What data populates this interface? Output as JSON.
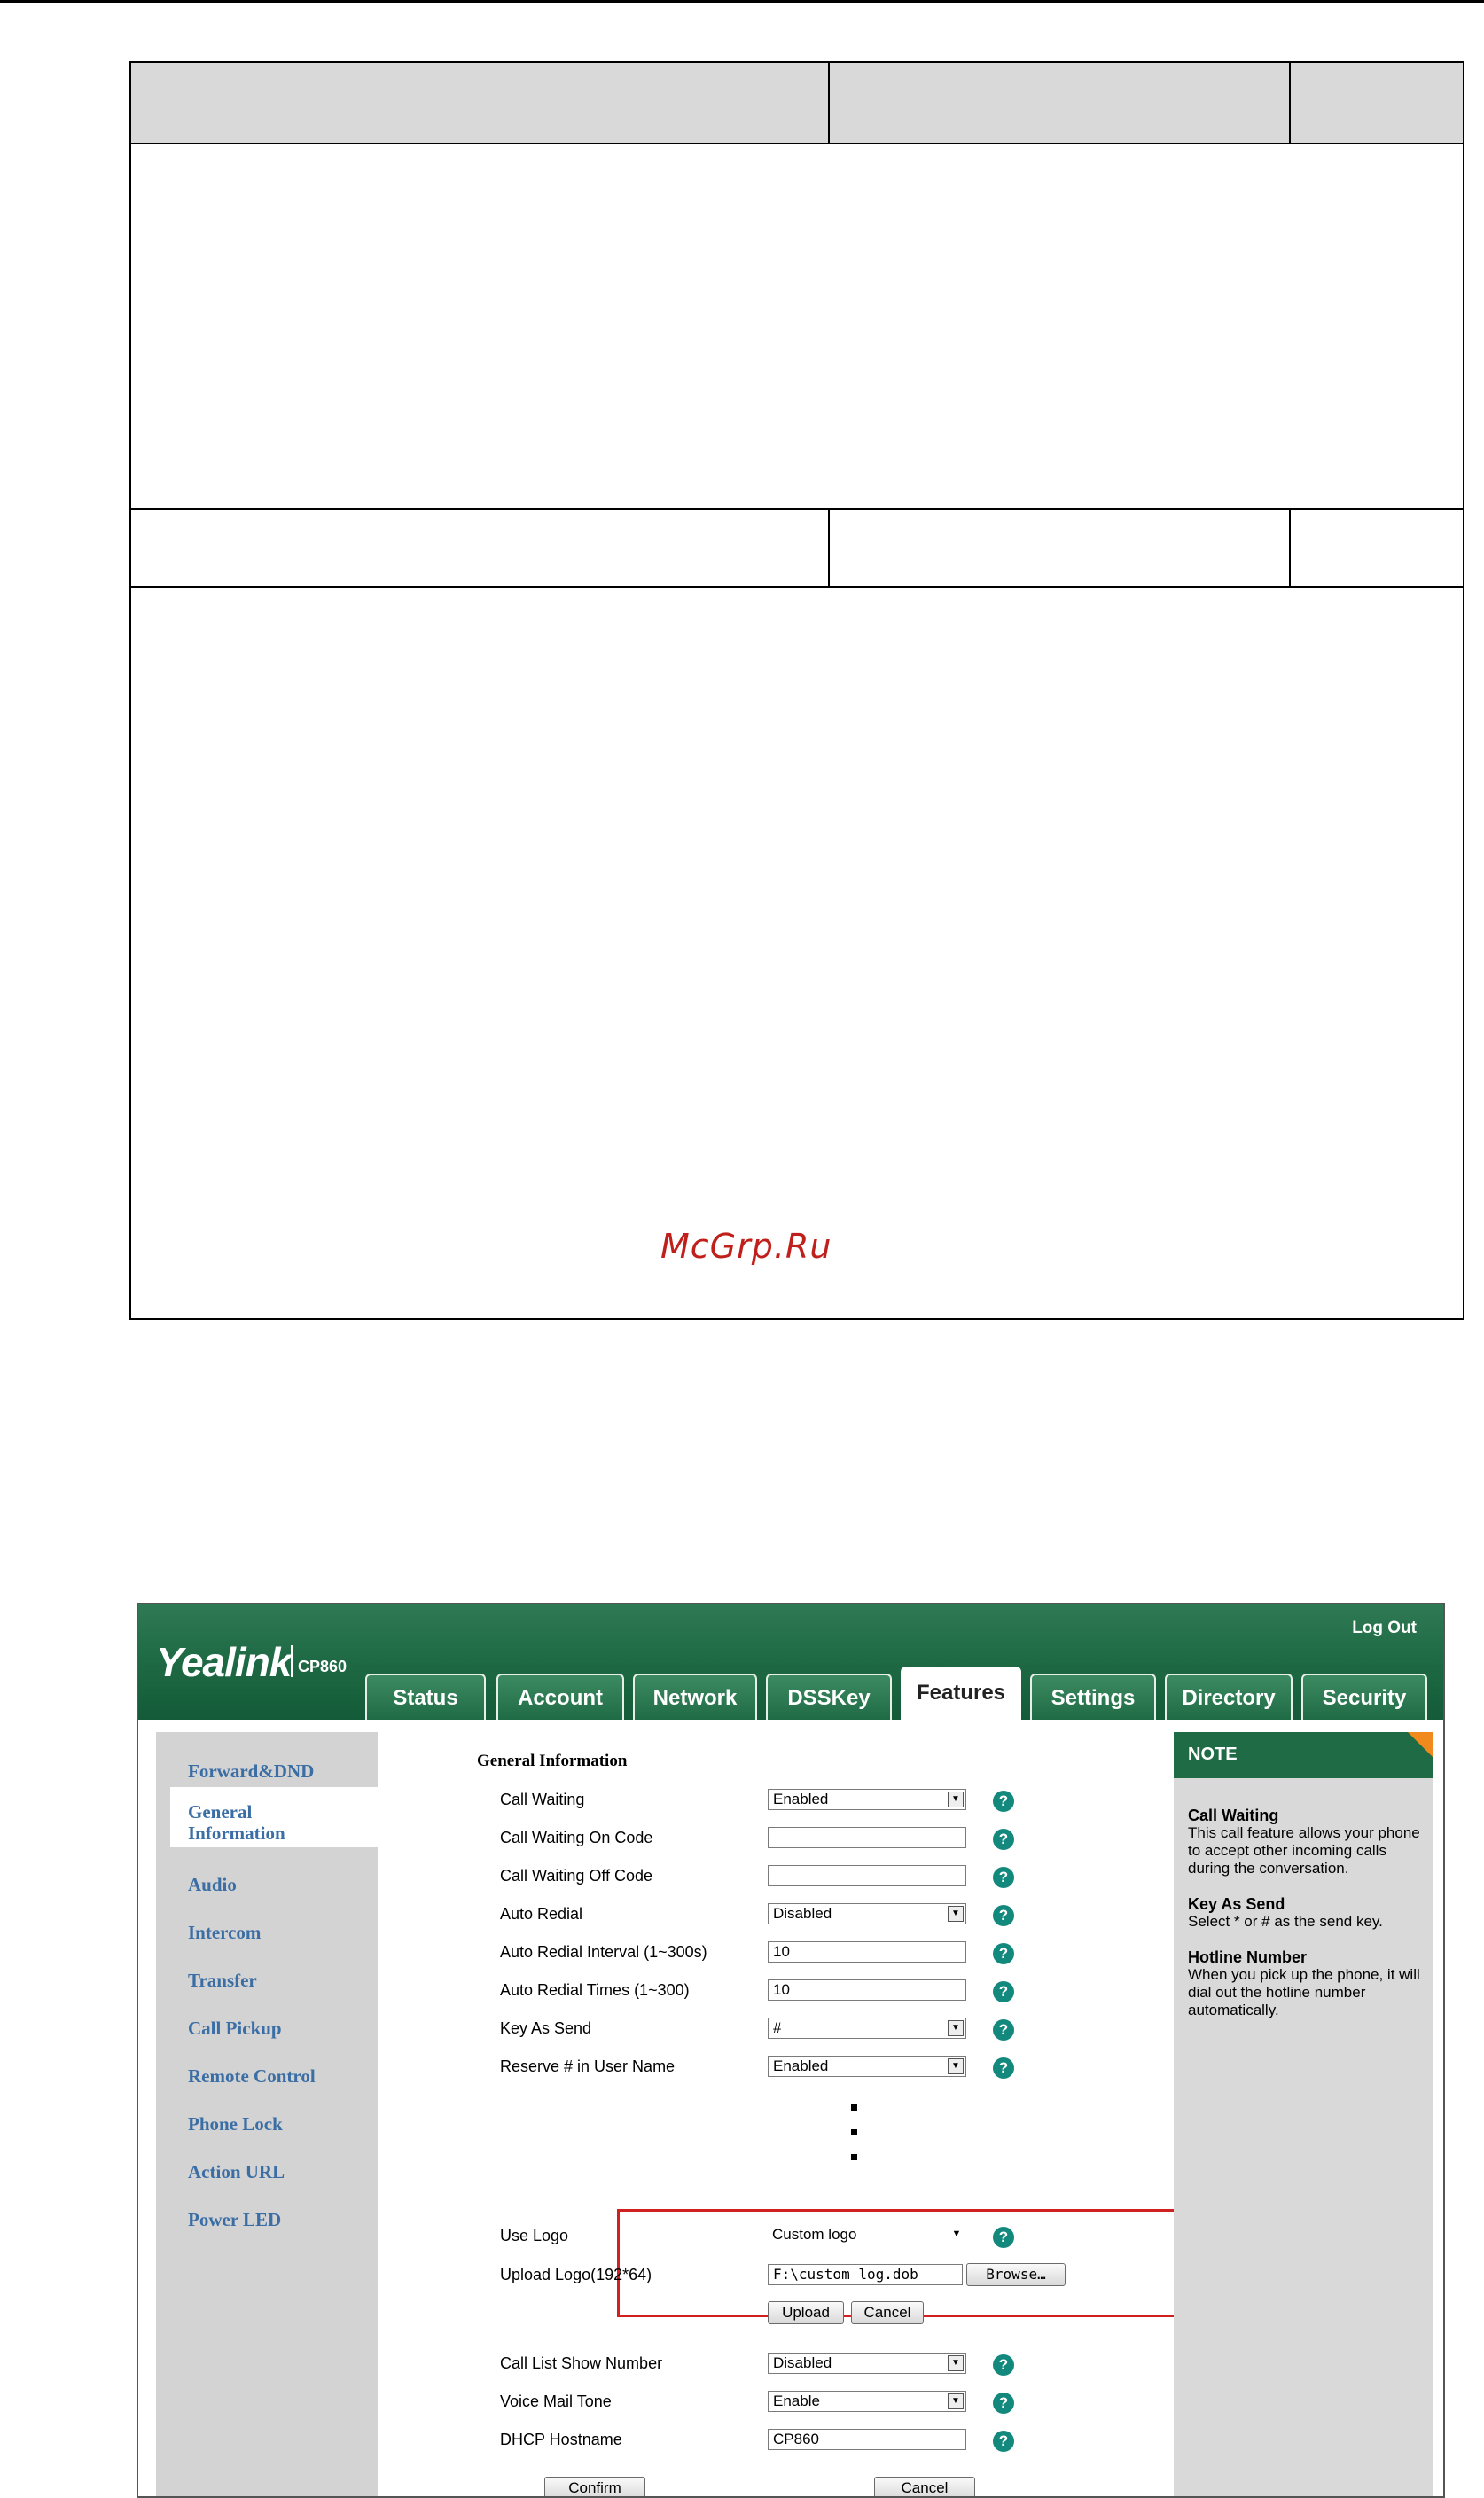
{
  "watermark": "McGrp.Ru",
  "ui": {
    "brand": "Yealink",
    "model": "CP860",
    "logout": "Log Out",
    "tabs": [
      "Status",
      "Account",
      "Network",
      "DSSKey",
      "Features",
      "Settings",
      "Directory",
      "Security"
    ],
    "active_tab": "Features",
    "sidebar": [
      "Forward&DND",
      "General Information",
      "Audio",
      "Intercom",
      "Transfer",
      "Call Pickup",
      "Remote Control",
      "Phone Lock",
      "Action URL",
      "Power LED"
    ],
    "active_sidebar": "General Information",
    "section_title": "General Information",
    "fields": {
      "call_waiting": {
        "label": "Call Waiting",
        "value": "Enabled"
      },
      "cw_on_code": {
        "label": "Call Waiting On Code",
        "value": ""
      },
      "cw_off_code": {
        "label": "Call Waiting Off Code",
        "value": ""
      },
      "auto_redial": {
        "label": "Auto Redial",
        "value": "Disabled"
      },
      "redial_interval": {
        "label": "Auto Redial Interval (1~300s)",
        "value": "10"
      },
      "redial_times": {
        "label": "Auto Redial Times (1~300)",
        "value": "10"
      },
      "key_as_send": {
        "label": "Key As Send",
        "value": "#"
      },
      "reserve_hash": {
        "label": "Reserve # in User Name",
        "value": "Enabled"
      },
      "use_logo": {
        "label": "Use Logo",
        "value": "Custom logo"
      },
      "upload_logo": {
        "label": "Upload Logo(192*64)",
        "value": "F:\\custom log.dob"
      },
      "call_list_show": {
        "label": "Call List Show Number",
        "value": "Disabled"
      },
      "voice_mail_tone": {
        "label": "Voice Mail Tone",
        "value": "Enable"
      },
      "dhcp_hostname": {
        "label": "DHCP Hostname",
        "value": "CP860"
      }
    },
    "buttons": {
      "browse": "Browse…",
      "upload": "Upload",
      "cancel_small": "Cancel",
      "confirm": "Confirm",
      "cancel": "Cancel"
    },
    "note": {
      "header": "NOTE",
      "items": [
        {
          "title": "Call Waiting",
          "text": "This call feature allows your phone to accept other incoming calls during the conversation."
        },
        {
          "title": "Key As Send",
          "text": "Select * or # as the send key."
        },
        {
          "title": "Hotline Number",
          "text": "When you pick up the phone, it will dial out the hotline number automatically."
        }
      ]
    },
    "help_icon": "?",
    "dropdown_icon": "chevron-down-icon"
  }
}
